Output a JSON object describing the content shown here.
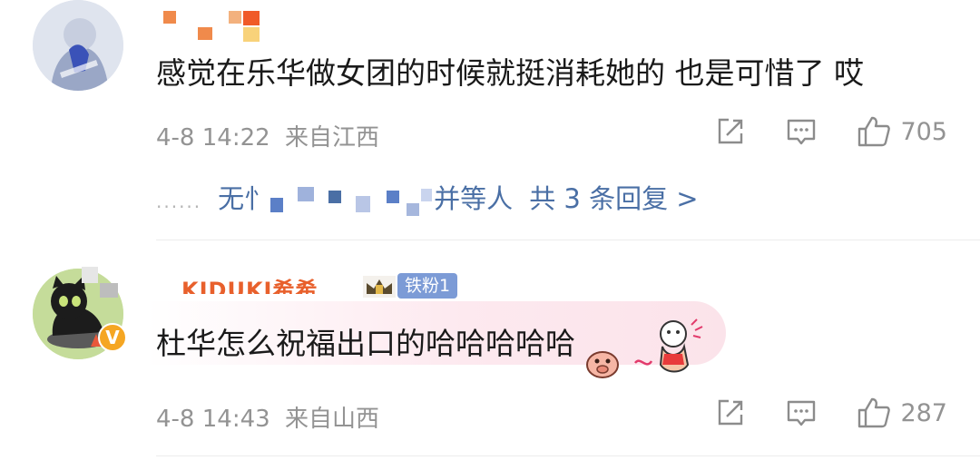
{
  "comments": [
    {
      "username": "",
      "text": "感觉在乐华做女团的时候就挺消耗她的 也是可惜了 哎",
      "time": "4-8 14:22",
      "location": "来自江西",
      "likes": "705",
      "replies": {
        "dots": "......",
        "names": "无忄",
        "names_suffix": "并等人",
        "count_text": "共 3 条回复 >"
      }
    },
    {
      "username": "KIDUKI希希",
      "fan_badge": "铁粉1",
      "text": "杜华怎么祝福出口的哈哈哈哈哈",
      "time": "4-8 14:43",
      "location": "来自山西",
      "likes": "287",
      "vip_badge": "V"
    }
  ],
  "icons": {
    "share": "share-icon",
    "comment": "comment-icon",
    "like": "thumbs-up-icon"
  },
  "colors": {
    "link": "#4a6fa5",
    "meta": "#939393",
    "fan_badge": "#7c9bd6",
    "vip": "#f5a623",
    "bubble": "#fbe3ea"
  }
}
